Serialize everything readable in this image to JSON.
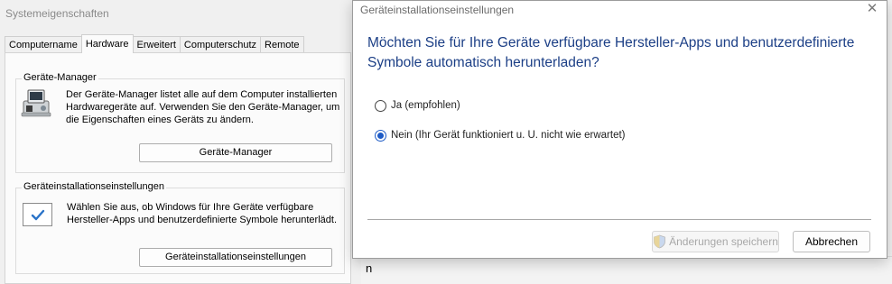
{
  "system_properties": {
    "title": "Systemeigenschaften",
    "tabs": [
      {
        "label": "Computername"
      },
      {
        "label": "Hardware"
      },
      {
        "label": "Erweitert"
      },
      {
        "label": "Computerschutz"
      },
      {
        "label": "Remote"
      }
    ],
    "device_manager": {
      "legend": "Geräte-Manager",
      "description_lines": [
        "Der Geräte-Manager listet alle auf dem Computer installierten",
        "Hardwaregeräte auf. Verwenden Sie den Geräte-Manager, um",
        "die Eigenschaften eines Geräts zu ändern."
      ],
      "button_label": "Geräte-Manager"
    },
    "device_installation": {
      "legend": "Geräteinstallationseinstellungen",
      "description_lines": [
        "Wählen Sie aus, ob Windows für Ihre Geräte verfügbare",
        "Hersteller-Apps und benutzerdefinierte Symbole herunterlädt."
      ],
      "button_label": "Geräteinstallationseinstellungen"
    }
  },
  "background_window": {
    "partial_text": "n"
  },
  "dialog": {
    "title": "Geräteinstallationseinstellungen",
    "close_icon": "close-icon",
    "question_lines": [
      "Möchten Sie für Ihre Geräte verfügbare Hersteller-Apps und benutzerdefinierte",
      "Symbole automatisch herunterladen?"
    ],
    "options": [
      {
        "label": "Ja (empfohlen)",
        "selected": false
      },
      {
        "label": "Nein (Ihr Gerät funktioniert u. U. nicht wie erwartet)",
        "selected": true
      }
    ],
    "save_label": "Änderungen speichern",
    "save_enabled": false,
    "save_icon": "uac-shield-icon",
    "cancel_label": "Abbrechen"
  },
  "colors": {
    "question_text": "#1c3f86",
    "radio_accent": "#1e5bc6",
    "disabled_text": "#a8a8a8"
  }
}
